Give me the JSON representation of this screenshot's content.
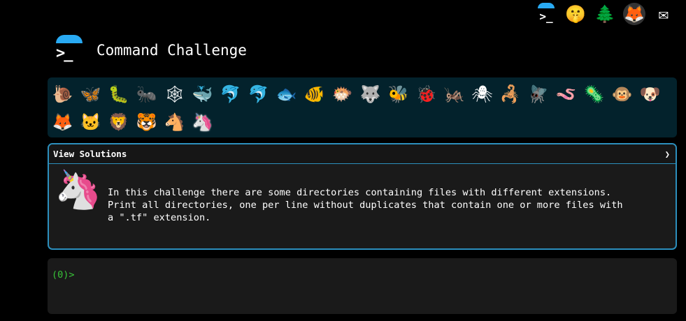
{
  "top_nav": [
    {
      "name": "terminal",
      "glyph": ">_"
    },
    {
      "name": "shushing-face",
      "glyph": "🤫"
    },
    {
      "name": "tree",
      "glyph": "🌲"
    },
    {
      "name": "gitlab-fox",
      "glyph": "🦊"
    },
    {
      "name": "envelope",
      "glyph": "✉"
    }
  ],
  "header": {
    "logo_glyph": ">_",
    "title": "Command Challenge"
  },
  "animals": [
    "🐌",
    "🦋",
    "🐛",
    "🐜",
    "🕸",
    "🐳",
    "🐬",
    "🐬",
    "🐟",
    "🐠",
    "🐡",
    "🐺",
    "🐝",
    "🐞",
    "🦗",
    "🕷",
    "🦂",
    "🪰",
    "🪱",
    "🦠",
    "🐵",
    "🐶",
    "🦊",
    "🐱",
    "🦁",
    "🐯",
    "🐴",
    "🦄"
  ],
  "animals_active_index": 27,
  "solutions": {
    "header_label": "View Solutions",
    "chevron": "❯",
    "unicorn": "🦄",
    "description": "In this challenge there are some directories containing files with different extensions.\nPrint all directories, one per line without duplicates that contain one or more files with\na \".tf\" extension."
  },
  "terminal": {
    "prompt": "(0)>"
  },
  "colors": {
    "accent": "#29aaf3",
    "border": "#2c8fbd",
    "panel_bg": "#03222c",
    "prompt_green": "#38c438"
  }
}
